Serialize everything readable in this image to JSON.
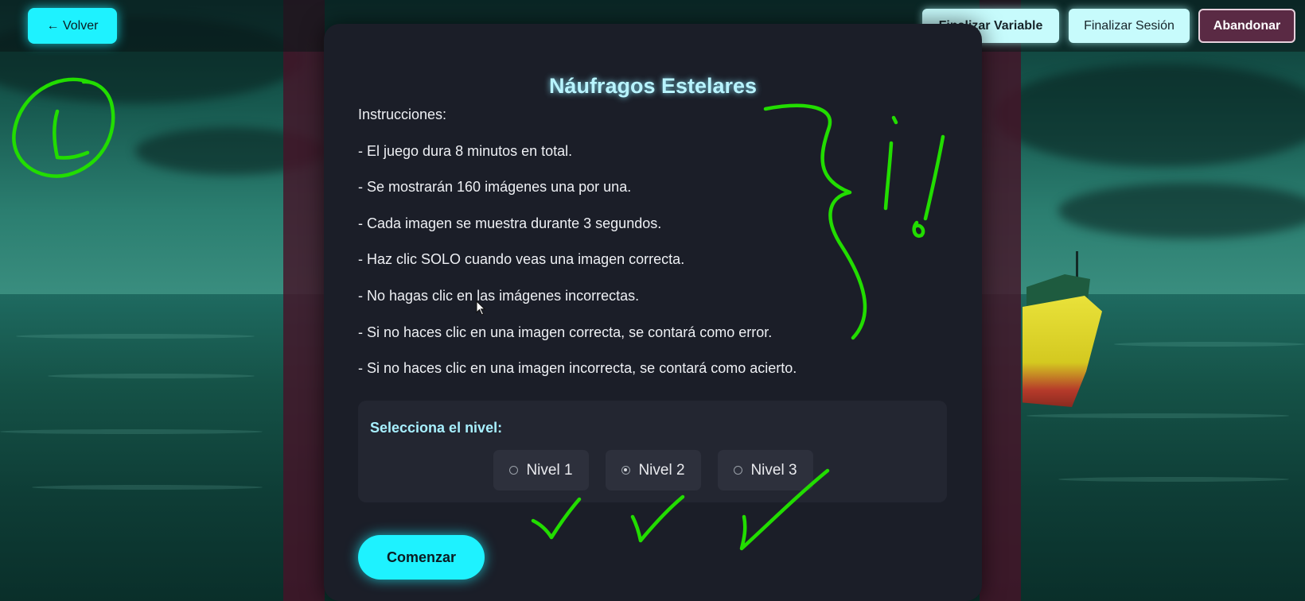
{
  "topbar": {
    "back_label": "← Volver",
    "finish_variable_label": "Finalizar Variable",
    "finish_session_label": "Finalizar Sesión",
    "abandon_label": "Abandonar"
  },
  "game": {
    "title": "Náufragos Estelares",
    "instructions_heading": "Instrucciones:",
    "instructions": [
      "- El juego dura 8 minutos en total.",
      "- Se mostrarán 160 imágenes una por una.",
      "- Cada imagen se muestra durante 3 segundos.",
      "- Haz clic SOLO cuando veas una imagen correcta.",
      "- No hagas clic en las imágenes incorrectas.",
      "- Si no haces clic en una imagen correcta, se contará como error.",
      "- Si no haces clic en una imagen incorrecta, se contará como acierto."
    ],
    "level_select_label": "Selecciona el nivel:",
    "levels": [
      {
        "label": "Nivel 1",
        "selected": false
      },
      {
        "label": "Nivel 2",
        "selected": true
      },
      {
        "label": "Nivel 3",
        "selected": false
      }
    ],
    "start_label": "Comenzar"
  },
  "colors": {
    "accent": "#1ef2ff",
    "card": "#1b1e28",
    "title": "#b8f4ff",
    "annotation": "#22dd00"
  },
  "icons": [
    "arrow-left-icon",
    "radio-icon",
    "mouse-cursor-icon"
  ]
}
